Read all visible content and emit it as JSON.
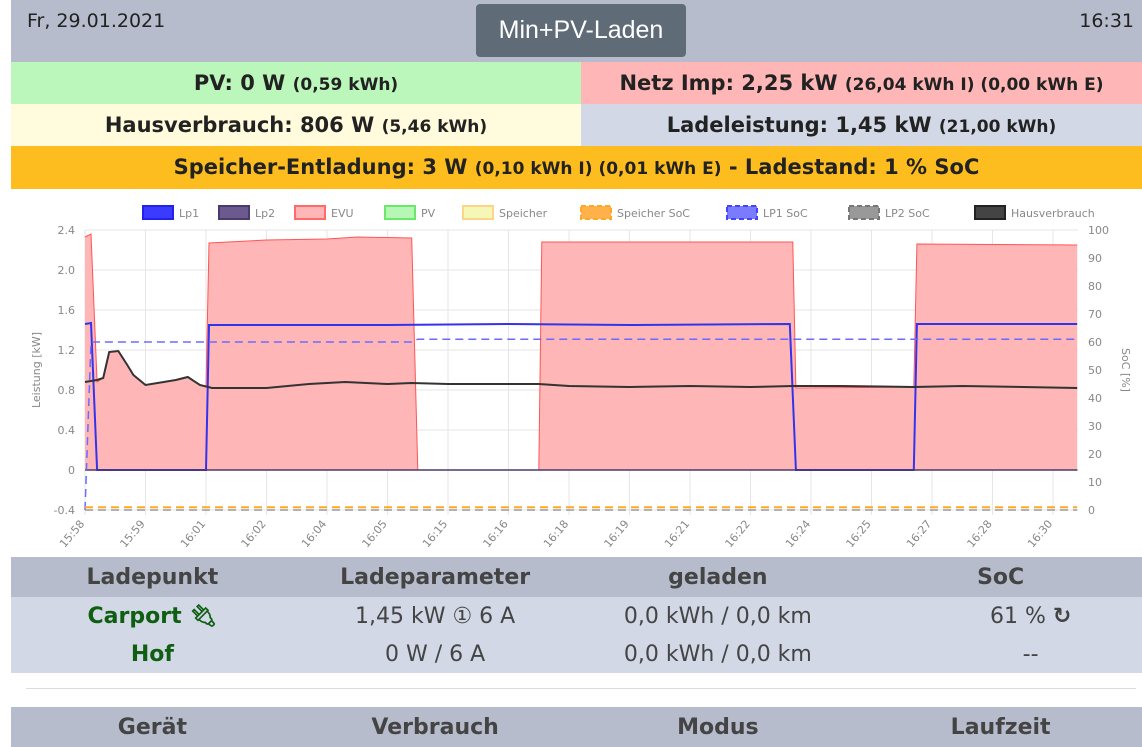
{
  "header": {
    "date": "Fr, 29.01.2021",
    "time": "16:31",
    "mode_button": "Min+PV-Laden"
  },
  "summary": {
    "pv": {
      "label": "PV: 0 W",
      "detail": "(0,59 kWh)",
      "color": "#bbf7bb"
    },
    "netz": {
      "label": "Netz Imp: 2,25 kW",
      "detail": "(26,04 kWh I) (0,00 kWh E)",
      "color": "#ffb6b6"
    },
    "haus": {
      "label": "Hausverbrauch: 806 W",
      "detail": "(5,46 kWh)",
      "color": "#fffbdc"
    },
    "lade": {
      "label": "Ladeleistung: 1,45 kW",
      "detail": "(21,00 kWh)",
      "color": "#d2d8e6"
    },
    "speicher": {
      "label": "Speicher-Entladung: 3 W",
      "detail": "(0,10 kWh I) (0,01 kWh E)",
      "suffix": "- Ladestand: 1 % SoC",
      "color": "#fdbd1e"
    }
  },
  "chart_data": {
    "type": "line",
    "ylabel": "Leistung [kW]",
    "y2label": "SoC [%]",
    "ylim": [
      -0.4,
      2.4
    ],
    "yticks": [
      "2.4",
      "2.0",
      "1.6",
      "1.2",
      "0.8",
      "0.4",
      "0",
      "-0.4"
    ],
    "y2lim": [
      0,
      100
    ],
    "y2ticks": [
      "100",
      "90",
      "80",
      "70",
      "60",
      "50",
      "40",
      "30",
      "20",
      "10",
      "0"
    ],
    "categories": [
      "15:58",
      "15:59",
      "16:01",
      "16:02",
      "16:04",
      "16:05",
      "16:15",
      "16:16",
      "16:18",
      "16:19",
      "16:21",
      "16:22",
      "16:24",
      "16:25",
      "16:27",
      "16:28",
      "16:30"
    ],
    "legend": [
      {
        "name": "Lp1",
        "fill": "#3b3bff",
        "stroke": "#2222ee",
        "dash": false
      },
      {
        "name": "Lp2",
        "fill": "#6a5a8e",
        "stroke": "#4a3a6e",
        "dash": false
      },
      {
        "name": "EVU",
        "fill": "#ffb6b6",
        "stroke": "#ff6b6b",
        "dash": false
      },
      {
        "name": "PV",
        "fill": "#b6f7b6",
        "stroke": "#6be86b",
        "dash": false
      },
      {
        "name": "Speicher",
        "fill": "#f5f7b6",
        "stroke": "#fcd58a",
        "dash": false
      },
      {
        "name": "Speicher SoC",
        "fill": "#ffb24a",
        "stroke": "#ffa726",
        "dash": true
      },
      {
        "name": "LP1 SoC",
        "fill": "#7b7bff",
        "stroke": "#4444ff",
        "dash": true
      },
      {
        "name": "LP2 SoC",
        "fill": "#999",
        "stroke": "#777",
        "dash": true
      },
      {
        "name": "Hausverbrauch",
        "fill": "#444",
        "stroke": "#222",
        "dash": false
      }
    ],
    "series": [
      {
        "name": "EVU",
        "axis": "left",
        "area": true,
        "color": "#ff5555",
        "points": [
          [
            0,
            2.33
          ],
          [
            0.1,
            2.36
          ],
          [
            0.2,
            0.88
          ],
          [
            0.3,
            0.92
          ],
          [
            0.4,
            1.18
          ],
          [
            0.55,
            1.19
          ],
          [
            0.7,
            1.05
          ],
          [
            0.8,
            0.95
          ],
          [
            1,
            0.85
          ],
          [
            1.3,
            0.88
          ],
          [
            1.5,
            0.9
          ],
          [
            1.7,
            0.93
          ],
          [
            1.9,
            0.85
          ],
          [
            2.0,
            0.83
          ],
          [
            2.05,
            2.27
          ],
          [
            3,
            2.3
          ],
          [
            4,
            2.31
          ],
          [
            4.5,
            2.33
          ],
          [
            5.4,
            2.32
          ],
          [
            5.5,
            0
          ],
          [
            7.5,
            0
          ],
          [
            7.55,
            2.28
          ],
          [
            9,
            2.28
          ],
          [
            10,
            2.28
          ],
          [
            11.7,
            2.28
          ],
          [
            11.75,
            0.82
          ],
          [
            13.7,
            0.83
          ],
          [
            13.75,
            2.26
          ],
          [
            16.4,
            2.25
          ]
        ]
      },
      {
        "name": "Lp1",
        "axis": "left",
        "color": "#3333ee",
        "width": 2,
        "points": [
          [
            0,
            1.46
          ],
          [
            0.1,
            1.47
          ],
          [
            0.2,
            0
          ],
          [
            2.0,
            0
          ],
          [
            2.05,
            1.45
          ],
          [
            5,
            1.45
          ],
          [
            7,
            1.46
          ],
          [
            9,
            1.45
          ],
          [
            11.65,
            1.46
          ],
          [
            11.75,
            0
          ],
          [
            13.7,
            0
          ],
          [
            13.75,
            1.46
          ],
          [
            16.4,
            1.46
          ]
        ]
      },
      {
        "name": "Hausverbrauch",
        "axis": "left",
        "color": "#333",
        "width": 2,
        "points": [
          [
            0,
            0.88
          ],
          [
            0.2,
            0.9
          ],
          [
            0.3,
            0.92
          ],
          [
            0.4,
            1.18
          ],
          [
            0.55,
            1.19
          ],
          [
            0.7,
            1.05
          ],
          [
            0.8,
            0.95
          ],
          [
            1,
            0.85
          ],
          [
            1.3,
            0.88
          ],
          [
            1.5,
            0.9
          ],
          [
            1.7,
            0.93
          ],
          [
            1.9,
            0.85
          ],
          [
            2.1,
            0.82
          ],
          [
            3,
            0.82
          ],
          [
            3.7,
            0.86
          ],
          [
            4.3,
            0.88
          ],
          [
            5,
            0.86
          ],
          [
            5.4,
            0.87
          ],
          [
            6,
            0.86
          ],
          [
            7.5,
            0.86
          ],
          [
            8,
            0.84
          ],
          [
            9,
            0.83
          ],
          [
            10,
            0.84
          ],
          [
            11,
            0.83
          ],
          [
            11.7,
            0.84
          ],
          [
            12.5,
            0.84
          ],
          [
            13.7,
            0.83
          ],
          [
            14.5,
            0.84
          ],
          [
            15.5,
            0.83
          ],
          [
            16.4,
            0.82
          ]
        ]
      },
      {
        "name": "Lp2",
        "axis": "left",
        "color": "#4a3a6e",
        "width": 1.5,
        "points": [
          [
            0,
            0
          ],
          [
            16.4,
            0
          ]
        ]
      },
      {
        "name": "LP1 SoC",
        "axis": "right",
        "dash": true,
        "color": "#6b6bff",
        "width": 1.5,
        "points": [
          [
            0,
            0
          ],
          [
            0.1,
            60
          ],
          [
            5.4,
            60
          ],
          [
            5.5,
            61
          ],
          [
            16.4,
            61
          ]
        ]
      },
      {
        "name": "Speicher SoC",
        "axis": "right",
        "dash": true,
        "color": "#ffa726",
        "width": 2,
        "points": [
          [
            0,
            1
          ],
          [
            16.4,
            1
          ]
        ]
      },
      {
        "name": "LP2 SoC",
        "axis": "right",
        "dash": true,
        "color": "#999",
        "width": 1.5,
        "points": [
          [
            0,
            0
          ],
          [
            16.4,
            0
          ]
        ]
      }
    ]
  },
  "ladepunkte": {
    "headers": [
      "Ladepunkt",
      "Ladeparameter",
      "geladen",
      "SoC"
    ],
    "rows": [
      {
        "name": "Carport",
        "icon": "plug-icon",
        "params": "1,45 kW ① 6 A",
        "geladen": "0,0 kWh / 0,0 km",
        "soc": "61 %",
        "soc_icon": "refresh-icon"
      },
      {
        "name": "Hof",
        "params": "0 W / 6 A",
        "geladen": "0,0 kWh / 0,0 km",
        "soc": "--"
      }
    ]
  },
  "geraete": {
    "headers": [
      "Gerät",
      "Verbrauch",
      "Modus",
      "Laufzeit"
    ]
  }
}
